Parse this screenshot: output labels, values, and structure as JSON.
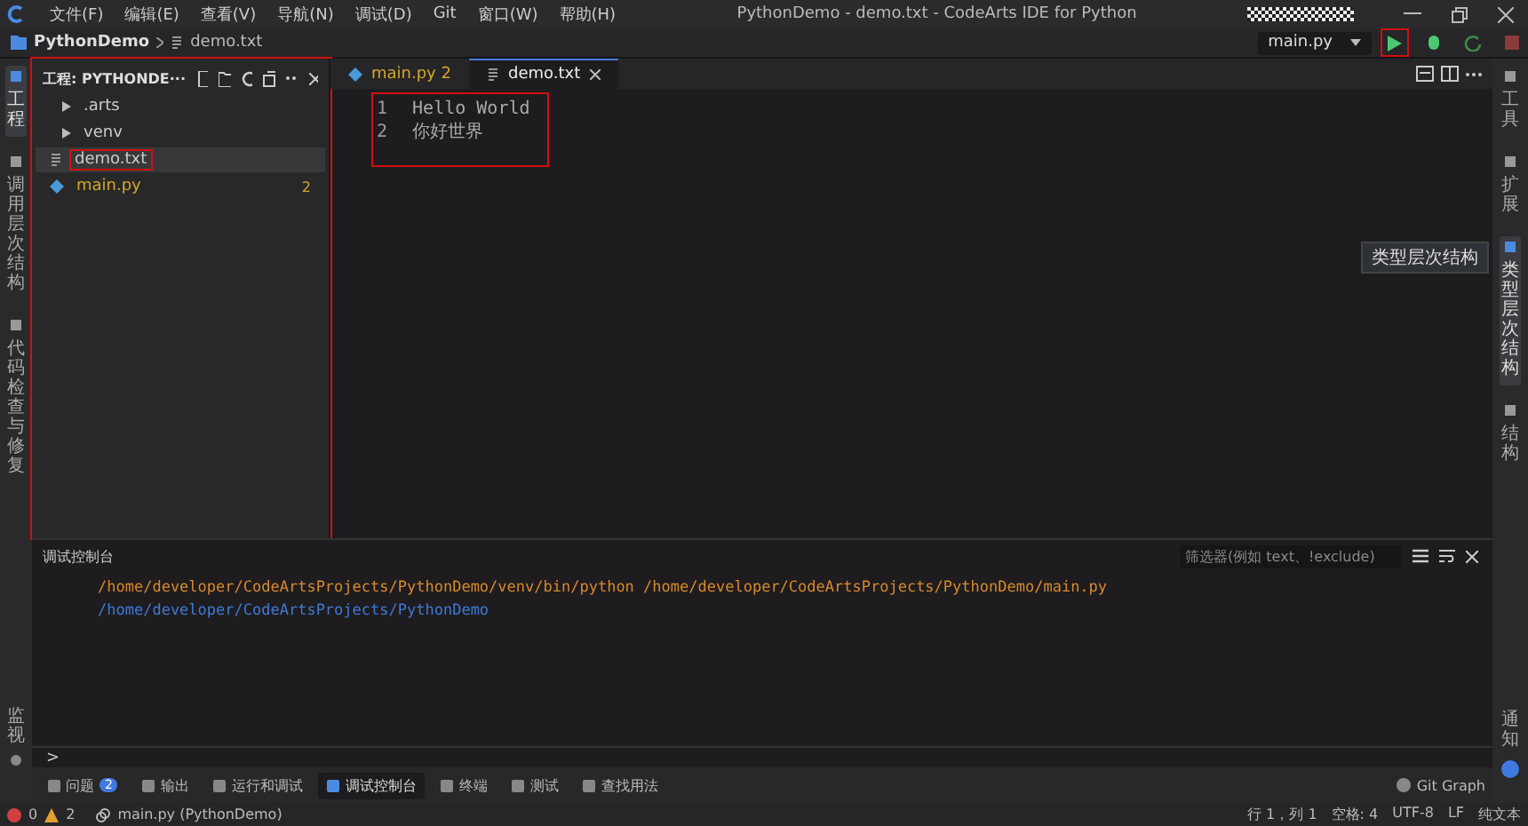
{
  "title_bar": {
    "menu": [
      "文件(F)",
      "编辑(E)",
      "查看(V)",
      "导航(N)",
      "调试(D)",
      "Git",
      "窗口(W)",
      "帮助(H)"
    ],
    "title": "PythonDemo - demo.txt - CodeArts IDE for Python"
  },
  "breadcrumb": [
    "PythonDemo",
    "demo.txt"
  ],
  "run_config": {
    "value": "main.py",
    "run_highlighted": true
  },
  "left_bar": [
    {
      "label": "工程",
      "selected": true
    },
    {
      "label": "调用层次结构",
      "selected": false
    },
    {
      "label": "代码检查与修复",
      "selected": false
    }
  ],
  "left_bar_bottom": "监视",
  "explorer": {
    "title": "工程: PYTHONDE···",
    "highlighted": true,
    "items": [
      {
        "kind": "folder",
        "label": ".arts",
        "selected": false,
        "highlighted": false
      },
      {
        "kind": "folder",
        "label": "venv",
        "selected": false,
        "highlighted": false
      },
      {
        "kind": "text",
        "label": "demo.txt",
        "selected": true,
        "highlighted": true
      },
      {
        "kind": "python",
        "label": "main.py",
        "badge": "2",
        "selected": false,
        "highlighted": false
      }
    ]
  },
  "editor": {
    "tabs": [
      {
        "kind": "python",
        "label": "main.py",
        "badge": "2",
        "selected": false
      },
      {
        "kind": "text",
        "label": "demo.txt",
        "selected": true
      }
    ],
    "highlighted": true,
    "lines": [
      {
        "number": "1",
        "text": "Hello World"
      },
      {
        "number": "2",
        "text": "你好世界"
      }
    ]
  },
  "right_bar": [
    {
      "label": "工具",
      "selected": false
    },
    {
      "label": "扩展",
      "selected": false
    },
    {
      "label": "类型层次结构",
      "selected": true
    },
    {
      "label": "结构",
      "selected": false
    }
  ],
  "right_bar_bottom": "通知",
  "tooltip": "类型层次结构",
  "panel": {
    "title": "调试控制台",
    "filter": {
      "placeholder": "筛选器(例如 text、!exclude)"
    },
    "lines": [
      {
        "kind": "command",
        "text": "/home/developer/CodeArtsProjects/PythonDemo/venv/bin/python /home/developer/CodeArtsProjects/PythonDemo/main.py"
      },
      {
        "kind": "path",
        "text": "/home/developer/CodeArtsProjects/PythonDemo"
      }
    ],
    "prompt": ">"
  },
  "bottom_tabs": [
    {
      "label": "问题",
      "badge": "2",
      "selected": false
    },
    {
      "label": "输出",
      "selected": false
    },
    {
      "label": "运行和调试",
      "selected": false
    },
    {
      "label": "调试控制台",
      "selected": true
    },
    {
      "label": "终端",
      "selected": false
    },
    {
      "label": "测试",
      "selected": false
    },
    {
      "label": "查找用法",
      "selected": false
    }
  ],
  "git_graph": "Git Graph",
  "status_bar": {
    "errors": "0",
    "warnings": "2",
    "interpreter": "main.py (PythonDemo)",
    "position": "行 1，列 1",
    "spaces": "空格: 4",
    "encoding": "UTF-8",
    "eol": "LF",
    "language": "纯文本"
  }
}
